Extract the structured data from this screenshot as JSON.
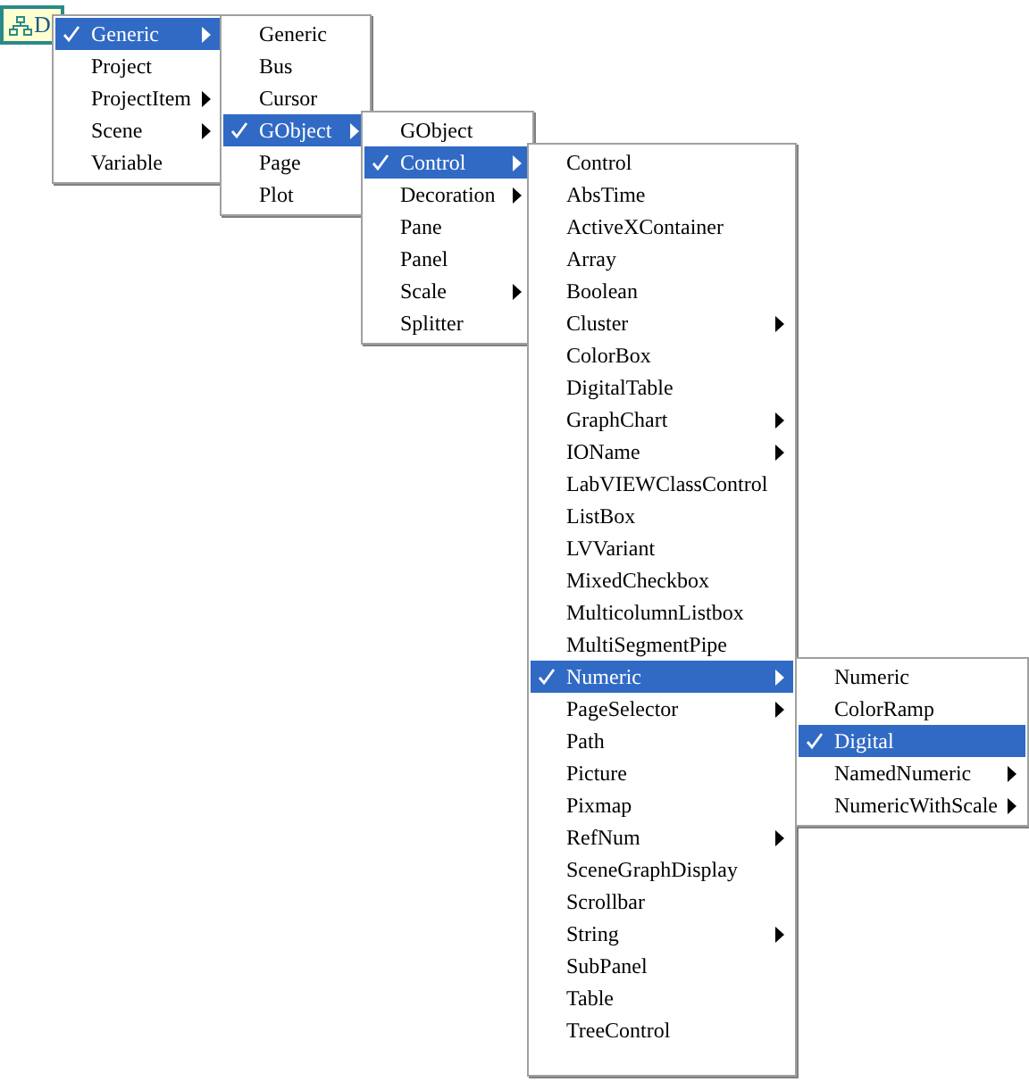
{
  "object_label": {
    "text": "D"
  },
  "menus": [
    {
      "items": [
        {
          "label": "Generic",
          "selected": true,
          "submenu": true
        },
        {
          "label": "Project",
          "selected": false,
          "submenu": false
        },
        {
          "label": "ProjectItem",
          "selected": false,
          "submenu": true
        },
        {
          "label": "Scene",
          "selected": false,
          "submenu": true
        },
        {
          "label": "Variable",
          "selected": false,
          "submenu": false
        }
      ]
    },
    {
      "items": [
        {
          "label": "Generic",
          "selected": false,
          "submenu": false
        },
        {
          "label": "Bus",
          "selected": false,
          "submenu": false
        },
        {
          "label": "Cursor",
          "selected": false,
          "submenu": false
        },
        {
          "label": "GObject",
          "selected": true,
          "submenu": true
        },
        {
          "label": "Page",
          "selected": false,
          "submenu": false
        },
        {
          "label": "Plot",
          "selected": false,
          "submenu": false
        }
      ]
    },
    {
      "items": [
        {
          "label": "GObject",
          "selected": false,
          "submenu": false
        },
        {
          "label": "Control",
          "selected": true,
          "submenu": true
        },
        {
          "label": "Decoration",
          "selected": false,
          "submenu": true
        },
        {
          "label": "Pane",
          "selected": false,
          "submenu": false
        },
        {
          "label": "Panel",
          "selected": false,
          "submenu": false
        },
        {
          "label": "Scale",
          "selected": false,
          "submenu": true
        },
        {
          "label": "Splitter",
          "selected": false,
          "submenu": false
        }
      ]
    },
    {
      "items": [
        {
          "label": "Control",
          "selected": false,
          "submenu": false
        },
        {
          "label": "AbsTime",
          "selected": false,
          "submenu": false
        },
        {
          "label": "ActiveXContainer",
          "selected": false,
          "submenu": false
        },
        {
          "label": "Array",
          "selected": false,
          "submenu": false
        },
        {
          "label": "Boolean",
          "selected": false,
          "submenu": false
        },
        {
          "label": "Cluster",
          "selected": false,
          "submenu": true
        },
        {
          "label": "ColorBox",
          "selected": false,
          "submenu": false
        },
        {
          "label": "DigitalTable",
          "selected": false,
          "submenu": false
        },
        {
          "label": "GraphChart",
          "selected": false,
          "submenu": true
        },
        {
          "label": "IOName",
          "selected": false,
          "submenu": true
        },
        {
          "label": "LabVIEWClassControl",
          "selected": false,
          "submenu": false
        },
        {
          "label": "ListBox",
          "selected": false,
          "submenu": false
        },
        {
          "label": "LVVariant",
          "selected": false,
          "submenu": false
        },
        {
          "label": "MixedCheckbox",
          "selected": false,
          "submenu": false
        },
        {
          "label": "MulticolumnListbox",
          "selected": false,
          "submenu": false
        },
        {
          "label": "MultiSegmentPipe",
          "selected": false,
          "submenu": false
        },
        {
          "label": "Numeric",
          "selected": true,
          "submenu": true
        },
        {
          "label": "PageSelector",
          "selected": false,
          "submenu": true
        },
        {
          "label": "Path",
          "selected": false,
          "submenu": false
        },
        {
          "label": "Picture",
          "selected": false,
          "submenu": false
        },
        {
          "label": "Pixmap",
          "selected": false,
          "submenu": false
        },
        {
          "label": "RefNum",
          "selected": false,
          "submenu": true
        },
        {
          "label": "SceneGraphDisplay",
          "selected": false,
          "submenu": false
        },
        {
          "label": "Scrollbar",
          "selected": false,
          "submenu": false
        },
        {
          "label": "String",
          "selected": false,
          "submenu": true
        },
        {
          "label": "SubPanel",
          "selected": false,
          "submenu": false
        },
        {
          "label": "Table",
          "selected": false,
          "submenu": false
        },
        {
          "label": "TreeControl",
          "selected": false,
          "submenu": false
        }
      ]
    },
    {
      "items": [
        {
          "label": "Numeric",
          "selected": false,
          "submenu": false
        },
        {
          "label": "ColorRamp",
          "selected": false,
          "submenu": false
        },
        {
          "label": "Digital",
          "selected": true,
          "submenu": false
        },
        {
          "label": "NamedNumeric",
          "selected": false,
          "submenu": true
        },
        {
          "label": "NumericWithScale",
          "selected": false,
          "submenu": true
        }
      ]
    }
  ]
}
